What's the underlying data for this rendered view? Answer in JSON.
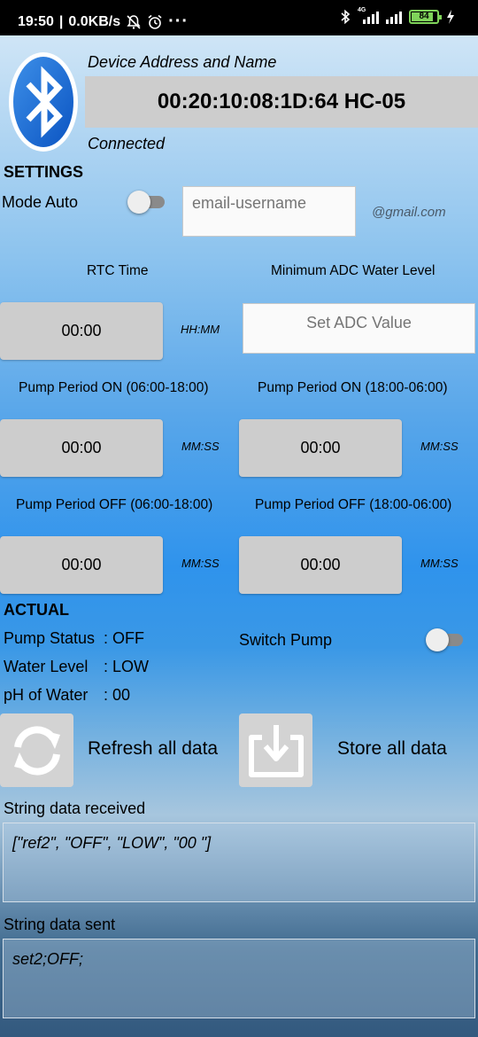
{
  "statusbar": {
    "time": "19:50",
    "network_speed": "0.0KB/s",
    "more": "···",
    "battery_level": "84",
    "network_type": "4G"
  },
  "device": {
    "address_label": "Device Address and Name",
    "address_value": "00:20:10:08:1D:64 HC-05",
    "connection_status": "Connected"
  },
  "settings": {
    "heading": "SETTINGS",
    "mode_auto_label": "Mode Auto",
    "email_placeholder": "email-username",
    "email_suffix": "@gmail.com",
    "rtc_time_label": "RTC Time",
    "rtc_time_value": "00:00",
    "rtc_time_format": "HH:MM",
    "adc_label": "Minimum ADC Water Level",
    "adc_placeholder": "Set ADC Value",
    "pump_on_day_label": "Pump Period ON (06:00-18:00)",
    "pump_on_day_value": "00:00",
    "pump_on_night_label": "Pump Period ON (18:00-06:00)",
    "pump_on_night_value": "00:00",
    "pump_off_day_label": "Pump Period OFF (06:00-18:00)",
    "pump_off_day_value": "00:00",
    "pump_off_night_label": "Pump Period OFF (18:00-06:00)",
    "pump_off_night_value": "00:00",
    "period_format": "MM:SS"
  },
  "actual": {
    "heading": "ACTUAL",
    "pump_status_label": "Pump Status",
    "pump_status_value": ": OFF",
    "water_level_label": "Water Level",
    "water_level_value": ": LOW",
    "ph_label": "pH of Water",
    "ph_value": ": 00",
    "switch_pump_label": "Switch Pump"
  },
  "actions": {
    "refresh_label": "Refresh all data",
    "store_label": "Store all data"
  },
  "data": {
    "received_label": "String data received",
    "received_value": "[\"ref2\", \"OFF\", \"LOW\", \"00 \"]",
    "sent_label": "String data sent",
    "sent_value": "set2;OFF;"
  },
  "icons": {
    "bluetooth": "bluetooth-icon",
    "refresh": "refresh-icon",
    "store": "download-icon"
  },
  "colors": {
    "bluetooth_blue": "#1f6fd6",
    "button_gray": "#cdcdcd"
  }
}
